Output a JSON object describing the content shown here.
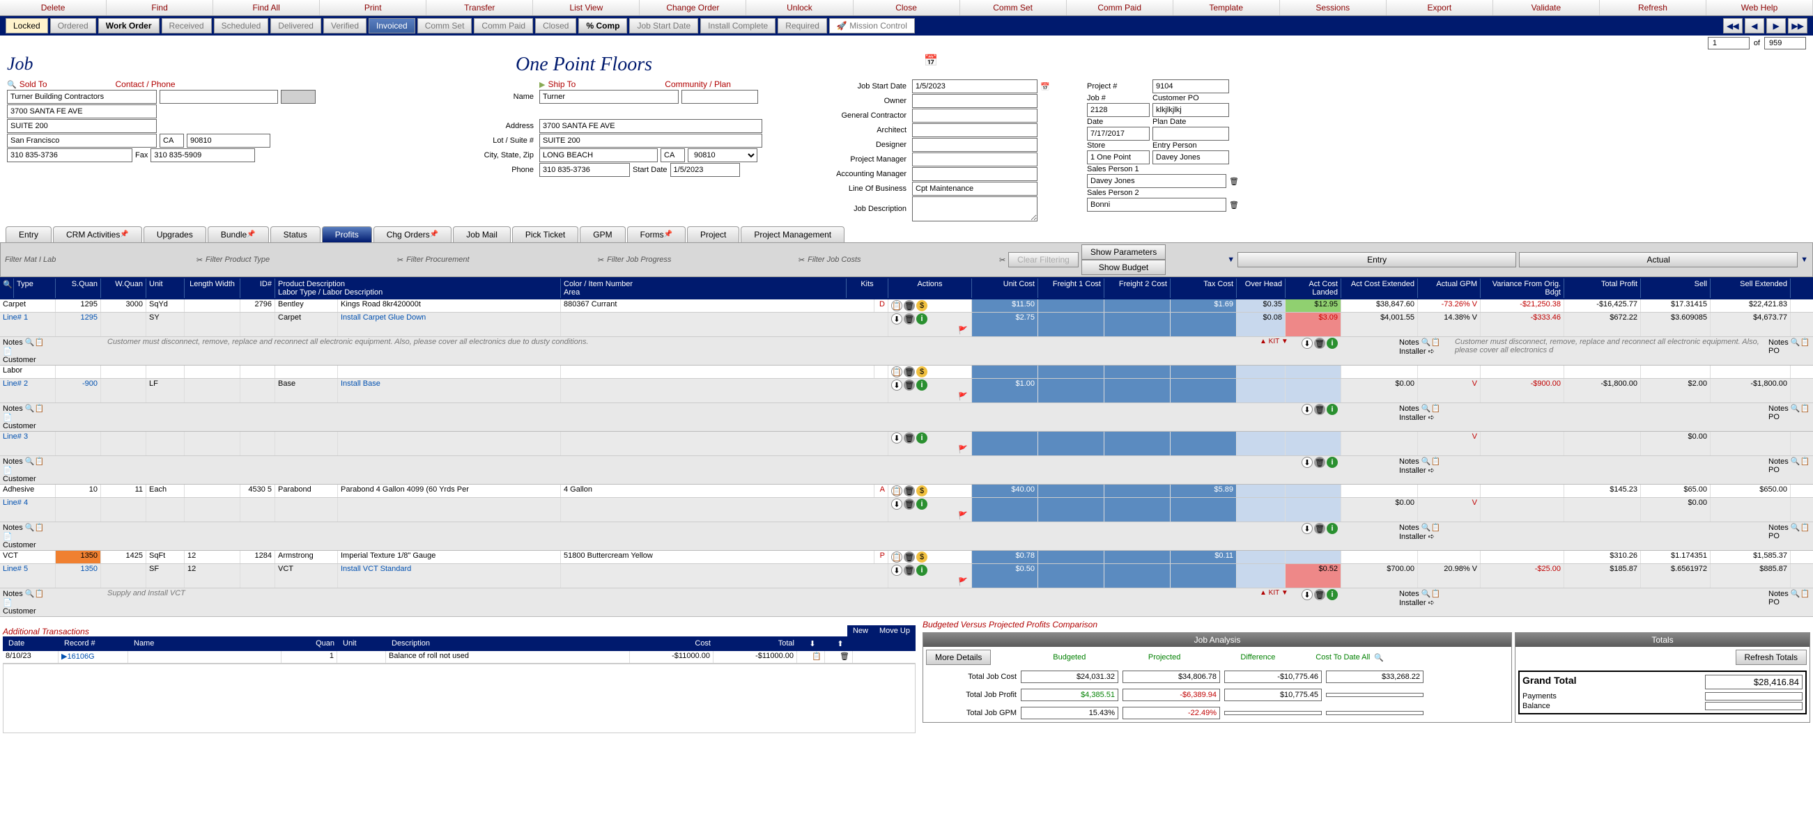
{
  "topmenu": [
    "Delete",
    "Find",
    "Find All",
    "Print",
    "Transfer",
    "List View",
    "Change Order",
    "Unlock",
    "Close",
    "Comm Set",
    "Comm Paid",
    "Template",
    "Sessions",
    "Export",
    "Validate",
    "Refresh",
    "Web Help"
  ],
  "statusBar": {
    "locked": "Locked",
    "ordered": "Ordered",
    "workOrder": "Work Order",
    "received": "Received",
    "scheduled": "Scheduled",
    "delivered": "Delivered",
    "verified": "Verified",
    "invoiced": "Invoiced",
    "commSet": "Comm Set",
    "commPaid": "Comm Paid",
    "closed": "Closed",
    "pctComp": "% Comp",
    "jobStart": "Job Start Date",
    "installComp": "Install Complete",
    "required": "Required",
    "mission": "Mission Control"
  },
  "recNav": {
    "cur": "1",
    "of": "of",
    "total": "959"
  },
  "header": {
    "job": "Job",
    "company": "One Point Floors"
  },
  "soldTo": {
    "label": "Sold To",
    "contactPhone": "Contact / Phone",
    "name": "Turner Building Contractors",
    "addr": "3700 SANTA FE AVE",
    "suite": "SUITE 200",
    "city": "San Francisco",
    "state": "CA",
    "zip": "90810",
    "phone": "310 835-3736",
    "faxLbl": "Fax",
    "fax": "310 835-5909"
  },
  "shipTo": {
    "label": "Ship To",
    "community": "Community / Plan",
    "nameLbl": "Name",
    "name": "Turner",
    "addrLbl": "Address",
    "addr": "3700 SANTA FE AVE",
    "lotLbl": "Lot / Suite #",
    "lot": "SUITE 200",
    "cszLbl": "City, State, Zip",
    "city": "LONG BEACH",
    "state": "CA",
    "zip": "90810",
    "phoneLbl": "Phone",
    "phone": "310 835-3736",
    "startLbl": "Start Date",
    "start": "1/5/2023"
  },
  "jobInfo": {
    "startLbl": "Job Start Date",
    "start": "1/5/2023",
    "ownerLbl": "Owner",
    "gcLbl": "General Contractor",
    "archLbl": "Architect",
    "desLbl": "Designer",
    "pmLbl": "Project Manager",
    "amLbl": "Accounting Manager",
    "lobLbl": "Line Of Business",
    "lob": "Cpt Maintenance",
    "jdLbl": "Job Description"
  },
  "projInfo": {
    "projNumLbl": "Project #",
    "projNum": "9104",
    "jobNumLbl": "Job #",
    "jobNum": "2128",
    "custPOLbl": "Customer PO",
    "custPO": "klkjlkjlkj",
    "dateLbl": "Date",
    "date": "7/17/2017",
    "planLbl": "Plan Date",
    "storeLbl": "Store",
    "store": "1 One Point",
    "entryLbl": "Entry Person",
    "entry": "Davey Jones",
    "sp1Lbl": "Sales Person 1",
    "sp1": "Davey Jones",
    "sp2Lbl": "Sales Person 2",
    "sp2": "Bonni"
  },
  "tabs": {
    "entry": "Entry",
    "crm": "CRM Activities",
    "upgrades": "Upgrades",
    "bundle": "Bundle",
    "status": "Status",
    "profits": "Profits",
    "chg": "Chg Orders",
    "mail": "Job Mail",
    "pick": "Pick Ticket",
    "gpm": "GPM",
    "forms": "Forms",
    "project": "Project",
    "pm": "Project Management"
  },
  "filters": {
    "matLab": "Filter Mat I Lab",
    "prodType": "Filter Product Type",
    "procure": "Filter Procurement",
    "progress": "Filter Job Progress",
    "costs": "Filter Job Costs",
    "clear": "Clear Filtering",
    "showParams": "Show Parameters",
    "showBudget": "Show Budget",
    "entryBtn": "Entry",
    "actualBtn": "Actual"
  },
  "cols": {
    "type": "Type",
    "squan": "S.Quan",
    "wquan": "W.Quan",
    "unit": "Unit",
    "lenW": "Length Width",
    "id": "ID#",
    "prodDesc": "Product Description",
    "labDesc": "Labor Type / Labor Description",
    "color": "Color / Item Number",
    "area": "Area",
    "kits": "Kits",
    "actions": "Actions",
    "unitCost": "Unit Cost",
    "freight1": "Freight 1 Cost",
    "freight2": "Freight 2 Cost",
    "taxCost": "Tax Cost",
    "overHead": "Over Head",
    "actLanded": "Act Cost Landed",
    "actExt": "Act Cost Extended",
    "actGPM": "Actual GPM",
    "variance": "Variance From Orig. Bdgt",
    "totProfit": "Total Profit",
    "sell": "Sell",
    "sellExt": "Sell Extended"
  },
  "lines": [
    {
      "type": "Carpet",
      "squan": "1295",
      "wquan": "3000",
      "unit": "SqYd",
      "id": "2796",
      "mfr": "Bentley",
      "prod": "Kings Road 8kr420000t",
      "color": "880367 Currant",
      "flag": "D",
      "unitCost": "$11.50",
      "taxCost": "$1.69",
      "oh": "$0.35",
      "landed": "$12.95",
      "ext": "$38,847.60",
      "gpm": "-73.26% V",
      "var": "-$21,250.38",
      "profit": "-$16,425.77",
      "sell": "$17.31415",
      "sellExt": "$22,421.83",
      "sub": {
        "lbl": "Line# 1",
        "q": "1295",
        "unit": "SY",
        "type": "Carpet",
        "desc": "Install Carpet Glue Down",
        "unitCost": "$2.75",
        "oh": "$0.08",
        "landed": "$3.09",
        "ext": "$4,001.55",
        "gpm": "14.38% V",
        "var": "-$333.46",
        "profit": "$672.22",
        "sell": "$3.609085",
        "sellExt": "$4,673.77"
      },
      "notes": "Customer must disconnect, remove, replace and reconnect all electronic equipment.  Also, please cover all electronics due to dusty conditions.",
      "kit": "KIT",
      "inotes": "Customer must disconnect, remove, replace and reconnect all electronic equipment.  Also, please cover all electronics d"
    },
    {
      "type": "Labor",
      "sub": {
        "lbl": "Line# 2",
        "q": "-900",
        "unit": "LF",
        "type": "Base",
        "desc": "Install Base",
        "unitCost": "$1.00",
        "ext": "$0.00",
        "ext2": "$0.00",
        "var": "-$900.00",
        "profit": "-$1,800.00",
        "sell": "$2.00",
        "sellExt": "-$1,800.00",
        "prevSell": "$0.00"
      }
    },
    {
      "sub": {
        "lbl": "Line# 3",
        "prevSell": "$0.00"
      }
    },
    {
      "type": "Adhesive",
      "squan": "10",
      "wquan": "11",
      "unit": "Each",
      "id": "4530 5",
      "mfr": "Parabond",
      "prod": "Parabond  4 Gallon 4099 (60 Yrds Per",
      "color": "4 Gallon",
      "flag": "A",
      "unitCost": "$40.00",
      "taxCost": "$5.89",
      "profit": "$145.23",
      "sell": "$65.00",
      "sellExt": "$650.00",
      "sub": {
        "lbl": "Line# 4",
        "ext": "$0.00",
        "ext2": "$0.00",
        "prevSell": "$0.00"
      }
    },
    {
      "type": "VCT",
      "squan": "1350",
      "wquan": "1425",
      "unit": "SqFt",
      "lw": "12",
      "id": "1284",
      "mfr": "Armstrong",
      "prod": "Imperial Texture 1/8\" Gauge",
      "color": "51800 Buttercream Yellow",
      "flag": "P",
      "unitCost": "$0.78",
      "taxCost": "$0.11",
      "profit": "$310.26",
      "sell": "$1.174351",
      "sellExt": "$1,585.37",
      "sub": {
        "lbl": "Line# 5",
        "q": "1350",
        "unit": "SF",
        "lw": "12",
        "type": "VCT",
        "desc": "Install VCT Standard",
        "unitCost": "$0.50",
        "landed": "$0.52",
        "ext": "$700.00",
        "gpm": "20.98% V",
        "var": "-$25.00",
        "profit": "$185.87",
        "sell": "$.6561972",
        "sellExt": "$885.87"
      },
      "notes": "Supply and Install VCT",
      "kit": "KIT",
      "squanHighlight": true
    }
  ],
  "noteLbls": {
    "notes": "Notes",
    "customer": "Customer",
    "installer": "Installer",
    "po": "PO"
  },
  "addTrans": {
    "title": "Additional Transactions",
    "new": "New",
    "moveUp": "Move Up",
    "cols": {
      "date": "Date",
      "rec": "Record #",
      "name": "Name",
      "quan": "Quan",
      "unit": "Unit",
      "desc": "Description",
      "cost": "Cost",
      "total": "Total"
    },
    "row": {
      "date": "8/10/23",
      "rec": "16106G",
      "q": "1",
      "desc": "Balance of roll not used",
      "cost": "-$11000.00",
      "total": "-$11000.00"
    }
  },
  "budgetComp": {
    "title": "Budgeted Versus Projected Profits Comparison",
    "jobAnal": "Job Analysis",
    "totals": "Totals",
    "more": "More Details",
    "budgeted": "Budgeted",
    "projected": "Projected",
    "diff": "Difference",
    "ctd": "Cost To Date All",
    "refresh": "Refresh Totals",
    "rows": [
      {
        "lbl": "Total Job Cost",
        "b": "$24,031.32",
        "p": "$34,806.78",
        "d": "-$10,775.46",
        "c": "$33,268.22"
      },
      {
        "lbl": "Total Job Profit",
        "b": "$4,385.51",
        "p": "-$6,389.94",
        "d": "$10,775.45",
        "c": ""
      },
      {
        "lbl": "Total Job GPM",
        "b": "15.43%",
        "p": "-22.49%",
        "d": "",
        "c": ""
      }
    ],
    "grand": "Grand Total",
    "grandVal": "$28,416.84",
    "pay": "Payments",
    "bal": "Balance"
  }
}
